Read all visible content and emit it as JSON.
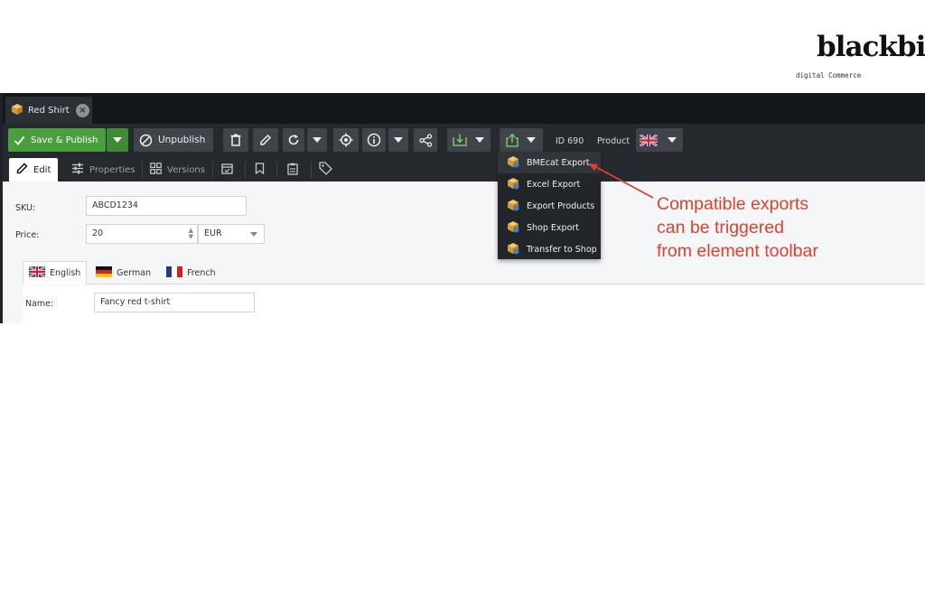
{
  "branding": {
    "logo": "blackbit",
    "tagline": "digital Commerce"
  },
  "window": {
    "tab_title": "Red Shirt"
  },
  "toolbar": {
    "save_publish": "Save & Publish",
    "unpublish": "Unpublish",
    "id_label": "ID 690",
    "type_label": "Product"
  },
  "subtabs": {
    "edit": "Edit",
    "properties": "Properties",
    "versions": "Versions"
  },
  "form": {
    "sku_label": "SKU:",
    "sku_value": "ABCD1234",
    "price_label": "Price:",
    "price_value": "20",
    "currency_value": "EUR",
    "name_label": "Name:",
    "name_value": "Fancy red t-shirt"
  },
  "languages": [
    {
      "label": "English",
      "active": true
    },
    {
      "label": "German",
      "active": false
    },
    {
      "label": "French",
      "active": false
    }
  ],
  "export_menu": {
    "items": [
      {
        "label": "BMEcat Export"
      },
      {
        "label": "Excel Export"
      },
      {
        "label": "Export Products"
      },
      {
        "label": "Shop Export"
      },
      {
        "label": "Transfer to Shop"
      }
    ]
  },
  "annotation": {
    "lines": [
      "Compatible exports",
      "can be triggered",
      "from element toolbar"
    ],
    "color": "#e0412e"
  },
  "colors": {
    "primary_green": "#4a9e3e",
    "toolbar_bg": "#262a2f",
    "tab_bg": "#13171b"
  }
}
